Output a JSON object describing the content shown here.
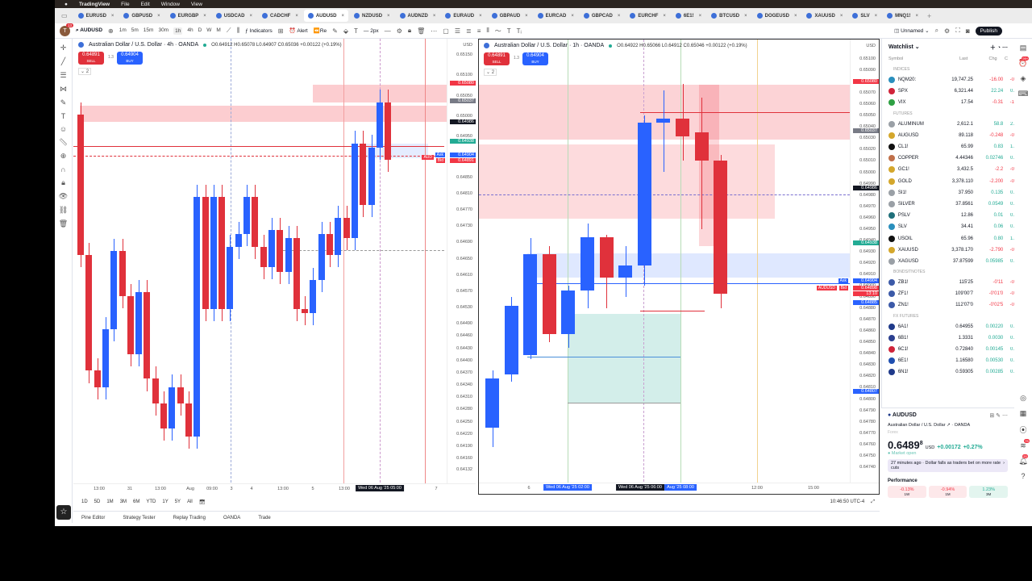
{
  "menubar": {
    "apple": "",
    "app": "TradingView",
    "items": [
      "File",
      "Edit",
      "Window",
      "View"
    ]
  },
  "tabs": [
    {
      "label": "EURUSD",
      "active": false
    },
    {
      "label": "GBPUSD",
      "active": false
    },
    {
      "label": "EURGBP",
      "active": false
    },
    {
      "label": "USDCAD",
      "active": false
    },
    {
      "label": "CADCHF",
      "active": false
    },
    {
      "label": "AUDUSD",
      "active": true
    },
    {
      "label": "NZDUSD",
      "active": false
    },
    {
      "label": "AUDNZD",
      "active": false
    },
    {
      "label": "EURAUD",
      "active": false
    },
    {
      "label": "GBPAUD",
      "active": false
    },
    {
      "label": "EURCAD",
      "active": false
    },
    {
      "label": "GBPCAD",
      "active": false
    },
    {
      "label": "EURCHF",
      "active": false
    },
    {
      "label": "6E1!",
      "active": false
    },
    {
      "label": "BTCUSD",
      "active": false
    },
    {
      "label": "DOGEUSD",
      "active": false
    },
    {
      "label": "XAUUSD",
      "active": false
    },
    {
      "label": "SLV",
      "active": false
    },
    {
      "label": "MNQ1!",
      "active": false
    }
  ],
  "toolbar": {
    "avatar_letter": "T",
    "avatar_badge": "13",
    "symbol": "AUDUSD",
    "timeframes": [
      "1m",
      "5m",
      "15m",
      "30m",
      "1h",
      "4h",
      "D",
      "W",
      "M"
    ],
    "active_tf": "1h",
    "indicators": "Indicators",
    "alert": "Alert",
    "replay": "Re",
    "stroke": "2px",
    "layout_name": "Unnamed",
    "publish": "Publish"
  },
  "charts": [
    {
      "title": "Australian Dollar / U.S. Dollar · 4h · OANDA",
      "ohlc": "O0.64912 H0.65078 L0.64907 C0.65036 +0.00122 (+0.19%)",
      "sell": "0.64891",
      "sell_label": "SELL",
      "spread": "1.3",
      "buy": "0.64904",
      "buy_label": "BUY",
      "collapse": "2",
      "currency": "USD",
      "price_ticks": [
        "0.65150",
        "0.65100",
        "0.65050",
        "0.65000",
        "0.64950",
        "0.64850",
        "0.64810",
        "0.64770",
        "0.64730",
        "0.64690",
        "0.64650",
        "0.64610",
        "0.64570",
        "0.64530",
        "0.64490",
        "0.64460",
        "0.64430",
        "0.64400",
        "0.64370",
        "0.64340",
        "0.64310",
        "0.64280",
        "0.64250",
        "0.64220",
        "0.64190",
        "0.64160",
        "0.64132"
      ],
      "price_tags": [
        {
          "v": "0.65080",
          "c": "#f23645"
        },
        {
          "v": "0.65037",
          "c": "#787b86"
        },
        {
          "v": "0.64986",
          "c": "#131722"
        },
        {
          "v": "0.64938",
          "c": "#22ab94"
        },
        {
          "v": "0.64904",
          "c": "#2962ff",
          "l": "Ask"
        },
        {
          "v": "0.64891",
          "c": "#f23645",
          "l": "Bid"
        }
      ],
      "pair_tag": "AUD",
      "time_ticks": [
        "13:00",
        "31",
        "13:00",
        "Aug",
        "09:00",
        "3",
        "4",
        "13:00",
        "5",
        "13:00",
        "Wed 06 Aug '25  05:00",
        "7"
      ],
      "candles_open": 0.65004,
      "candles_close": [
        0.64659,
        0.64375,
        0.64335,
        0.64477,
        0.64669,
        0.64558,
        0.64416,
        0.64568,
        0.64355,
        0.64294,
        0.64233,
        0.64335,
        0.64294,
        0.64213,
        0.64801,
        0.64527,
        0.64801,
        0.64527,
        0.64679,
        0.6471,
        0.64801,
        0.64679,
        0.64629,
        0.6472,
        0.64618,
        0.647,
        0.64527,
        0.64517,
        0.64598,
        0.6471,
        0.64659,
        0.6475,
        0.647,
        0.64933,
        0.64781,
        0.64923,
        0.65034,
        0.64892
      ]
    },
    {
      "title": "Australian Dollar / U.S. Dollar · 1h · OANDA",
      "ohlc": "O0.64922 H0.65066 L0.64912 C0.65046 +0.00122 (+0.19%)",
      "sell": "0.64891",
      "sell_label": "SELL",
      "spread": "1.3",
      "buy": "0.64904",
      "buy_label": "BUY",
      "collapse": "2",
      "currency": "USD",
      "price_ticks": [
        "0.65100",
        "0.65090",
        "0.65080",
        "0.65070",
        "0.65060",
        "0.65050",
        "0.65040",
        "0.65030",
        "0.65020",
        "0.65010",
        "0.65000",
        "0.64990",
        "0.64980",
        "0.64970",
        "0.64960",
        "0.64950",
        "0.64940",
        "0.64930",
        "0.64920",
        "0.64910",
        "0.64900",
        "0.64890",
        "0.64880",
        "0.64870",
        "0.64860",
        "0.64850",
        "0.64840",
        "0.64830",
        "0.64820",
        "0.64810",
        "0.64800",
        "0.64790",
        "0.64780",
        "0.64770",
        "0.64760",
        "0.64750",
        "0.64740"
      ],
      "price_tags": [
        {
          "v": "0.65080",
          "c": "#f23645"
        },
        {
          "v": "0.65037",
          "c": "#787b86"
        },
        {
          "v": "0.64986",
          "c": "#131722"
        },
        {
          "v": "0.64938",
          "c": "#22ab94"
        },
        {
          "v": "0.64904",
          "c": "#2962ff",
          "l": "Ask"
        },
        {
          "v": "0.64898",
          "c": "#f23645",
          "l": "Bid"
        },
        {
          "v": "0.64885",
          "c": "#2962ff"
        },
        {
          "v": "0.64807",
          "c": "#2962ff"
        }
      ],
      "pair_tag": "AUDUSD",
      "countdown": "13:10",
      "time_ticks": [
        "6",
        "Wed 06 Aug '25  02:00",
        "Wed 06 Aug '25  06:00",
        "Aug '25  08:00",
        "12:00",
        "15:00"
      ],
      "candles": [
        [
          0.64775,
          0.64825,
          0.64758,
          0.64818
        ],
        [
          0.64822,
          0.6489,
          0.64815,
          0.64882
        ],
        [
          0.64839,
          0.64942,
          0.64835,
          0.64928
        ],
        [
          0.64928,
          0.64935,
          0.6485,
          0.64857
        ],
        [
          0.64857,
          0.649,
          0.64845,
          0.64896
        ],
        [
          0.64896,
          0.64955,
          0.6488,
          0.64943
        ],
        [
          0.64943,
          0.64945,
          0.6488,
          0.64907
        ],
        [
          0.64907,
          0.64935,
          0.6489,
          0.64918
        ],
        [
          0.64918,
          0.6505,
          0.649,
          0.65044
        ],
        [
          0.65044,
          0.65072,
          0.65,
          0.65047
        ],
        [
          0.65047,
          0.65078,
          0.6501,
          0.65032
        ],
        [
          0.65035,
          0.65066,
          0.6495,
          0.6501
        ],
        [
          0.6501,
          0.65015,
          0.6488,
          0.64893
        ]
      ]
    }
  ],
  "watchlist": {
    "title": "Watchlist",
    "col_symbol": "Symbol",
    "col_last": "Last",
    "col_chg": "Chg",
    "col_pct": "C",
    "sections": [
      {
        "name": "INDICES",
        "rows": [
          {
            "s": "NQM20:",
            "l": "19,747.25",
            "c": "-16.00",
            "p": "-0",
            "ic": "#2a8fbd"
          },
          {
            "s": "SPX",
            "l": "6,321.44",
            "c": "22.24",
            "p": "0.",
            "ic": "#d0243a"
          },
          {
            "s": "VIX",
            "l": "17.54",
            "c": "-0.31",
            "p": "-1",
            "ic": "#2ea043"
          }
        ]
      },
      {
        "name": "FUTURES",
        "rows": [
          {
            "s": "ALUMINUM",
            "l": "2,612.1",
            "c": "58.8",
            "p": "2.",
            "ic": "#9aa0a6"
          },
          {
            "s": "AUGUSD",
            "l": "89.118",
            "c": "-0.248",
            "p": "-0",
            "ic": "#d4a72c"
          },
          {
            "s": "CL1!",
            "l": "65.99",
            "c": "0.83",
            "p": "1.",
            "ic": "#111111"
          },
          {
            "s": "COPPER",
            "l": "4.44346",
            "c": "0.02746",
            "p": "0.",
            "ic": "#c0704a"
          },
          {
            "s": "GC1!",
            "l": "3,432.5",
            "c": "-2.2",
            "p": "-0",
            "ic": "#d4a72c"
          },
          {
            "s": "GOLD",
            "l": "3,378.110",
            "c": "-2.200",
            "p": "-0",
            "ic": "#d4a72c"
          },
          {
            "s": "SI1!",
            "l": "37.950",
            "c": "0.135",
            "p": "0.",
            "ic": "#9aa0a6"
          },
          {
            "s": "SILVER",
            "l": "37.8561",
            "c": "0.0549",
            "p": "0.",
            "ic": "#9aa0a6"
          },
          {
            "s": "PSLV",
            "l": "12.86",
            "c": "0.01",
            "p": "0.",
            "ic": "#1f6f7a"
          },
          {
            "s": "SLV",
            "l": "34.41",
            "c": "0.06",
            "p": "0.",
            "ic": "#2a8fbd"
          },
          {
            "s": "USOIL",
            "l": "65.96",
            "c": "0.80",
            "p": "1.",
            "ic": "#111111"
          },
          {
            "s": "XAUUSD",
            "l": "3,378.170",
            "c": "-2.790",
            "p": "-0",
            "ic": "#d4a72c"
          },
          {
            "s": "XAGUSD",
            "l": "37.87599",
            "c": "0.05985",
            "p": "0.",
            "ic": "#9aa0a6"
          }
        ]
      },
      {
        "name": "BONDS/TNOTES",
        "rows": [
          {
            "s": "ZB1!",
            "l": "115'25",
            "c": "-0'11",
            "p": "-0",
            "ic": "#3c5aa8"
          },
          {
            "s": "ZF1!",
            "l": "109'00'7",
            "c": "-0'01'0",
            "p": "-0",
            "ic": "#3c5aa8"
          },
          {
            "s": "ZN1!",
            "l": "112'07'0",
            "c": "-0'02'5",
            "p": "-0",
            "ic": "#3c5aa8"
          }
        ]
      },
      {
        "name": "FX FUTURES",
        "rows": [
          {
            "s": "6A1!",
            "l": "0.64955",
            "c": "0.00220",
            "p": "0.",
            "ic": "#1f3a8a"
          },
          {
            "s": "6B1!",
            "l": "1.3331",
            "c": "0.0030",
            "p": "0.",
            "ic": "#2b3f8f"
          },
          {
            "s": "6C1!",
            "l": "0.72840",
            "c": "0.00145",
            "p": "0.",
            "ic": "#d0243a"
          },
          {
            "s": "6E1!",
            "l": "1.16580",
            "c": "0.00530",
            "p": "0.",
            "ic": "#1f4fb0"
          },
          {
            "s": "6N1!",
            "l": "0.59305",
            "c": "0.00285",
            "p": "0.",
            "ic": "#1f3a8a"
          }
        ]
      }
    ]
  },
  "detail": {
    "symbol": "AUDUSD",
    "name": "Australian Dollar / U.S. Dollar",
    "broker": "OANDA",
    "type": "Forex",
    "price": "0.6489",
    "price_sup": "8",
    "currency": "USD",
    "change": "+0.00172",
    "change_pct": "+0.27%",
    "market": "Market open",
    "news": "27 minutes ago · Dollar falls as traders bet on more rate cuts",
    "performance": "Performance",
    "perf": [
      {
        "v": "-0.13%",
        "p": "1W",
        "up": false
      },
      {
        "v": "-0.94%",
        "p": "1M",
        "up": false
      },
      {
        "v": "1.23%",
        "p": "3M",
        "up": true
      }
    ]
  },
  "rightbar": {
    "badge1": "99+",
    "badge2": "75",
    "badge3": "20"
  },
  "ranges": [
    "1D",
    "5D",
    "1M",
    "3M",
    "6M",
    "YTD",
    "1Y",
    "5Y",
    "All"
  ],
  "clock": "10:46:50 UTC-4",
  "bottom_tabs": [
    "Pine Editor",
    "Strategy Tester",
    "Replay Trading",
    "OANDA",
    "Trade"
  ],
  "colors": {
    "up": "#2962ff",
    "down": "#e0313b",
    "accent": "#2962ff"
  }
}
